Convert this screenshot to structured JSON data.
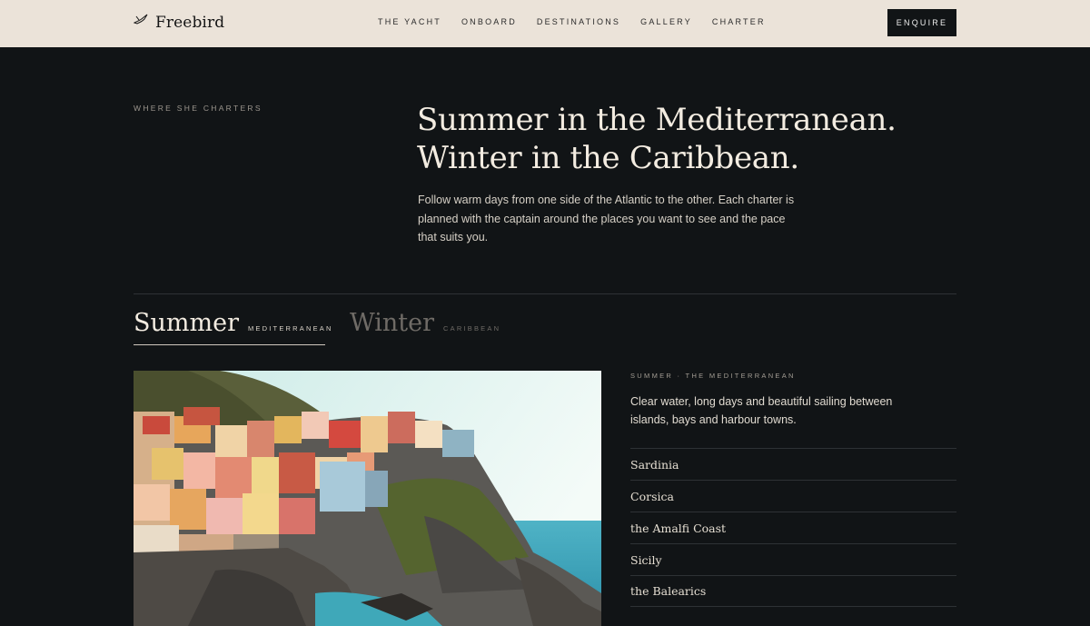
{
  "brand": {
    "name": "Freebird",
    "icon": "bird-logo-icon"
  },
  "nav": {
    "items": [
      "THE YACHT",
      "ONBOARD",
      "DESTINATIONS",
      "GALLERY",
      "CHARTER"
    ],
    "cta_label": "ENQUIRE"
  },
  "hero": {
    "eyebrow": "WHERE SHE CHARTERS",
    "headline_line1": "Summer in the Mediterranean.",
    "headline_line2": "Winter in the Caribbean.",
    "intro": "Follow warm days from one side of the Atlantic to the other. Each charter is planned with the captain around the places you want to see and the pace that suits you."
  },
  "tabs": [
    {
      "title": "Summer",
      "subtitle": "MEDITERRANEAN",
      "active": true
    },
    {
      "title": "Winter",
      "subtitle": "CARIBBEAN",
      "active": false
    }
  ],
  "detail": {
    "eyebrow": "SUMMER · THE MEDITERRANEAN",
    "description": "Clear water, long days and beautiful sailing between islands, bays and harbour towns.",
    "destinations": [
      "Sardinia",
      "Corsica",
      "the Amalfi Coast",
      "Sicily",
      "the Balearics"
    ]
  },
  "colors": {
    "background": "#111416",
    "topbar": "#ebe3d9",
    "accent_text": "#f3ece1",
    "muted_text": "#6f6b66"
  }
}
